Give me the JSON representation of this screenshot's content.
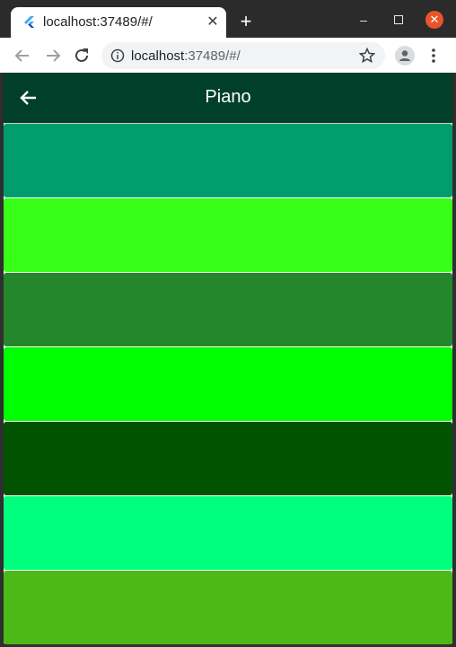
{
  "browser": {
    "tab": {
      "title": "localhost:37489/#/"
    },
    "url": {
      "host": "localhost",
      "rest": ":37489/#/"
    }
  },
  "app": {
    "title": "Piano",
    "keys": [
      {
        "name": "key-1",
        "color": "#009e6c"
      },
      {
        "name": "key-2",
        "color": "#37ff17"
      },
      {
        "name": "key-3",
        "color": "#25872b"
      },
      {
        "name": "key-4",
        "color": "#00ff00"
      },
      {
        "name": "key-5",
        "color": "#025300"
      },
      {
        "name": "key-6",
        "color": "#00ff7e"
      },
      {
        "name": "key-7",
        "color": "#4cb917"
      }
    ]
  },
  "colors": {
    "appbar": "#00402b",
    "window_close": "#e9542b"
  }
}
